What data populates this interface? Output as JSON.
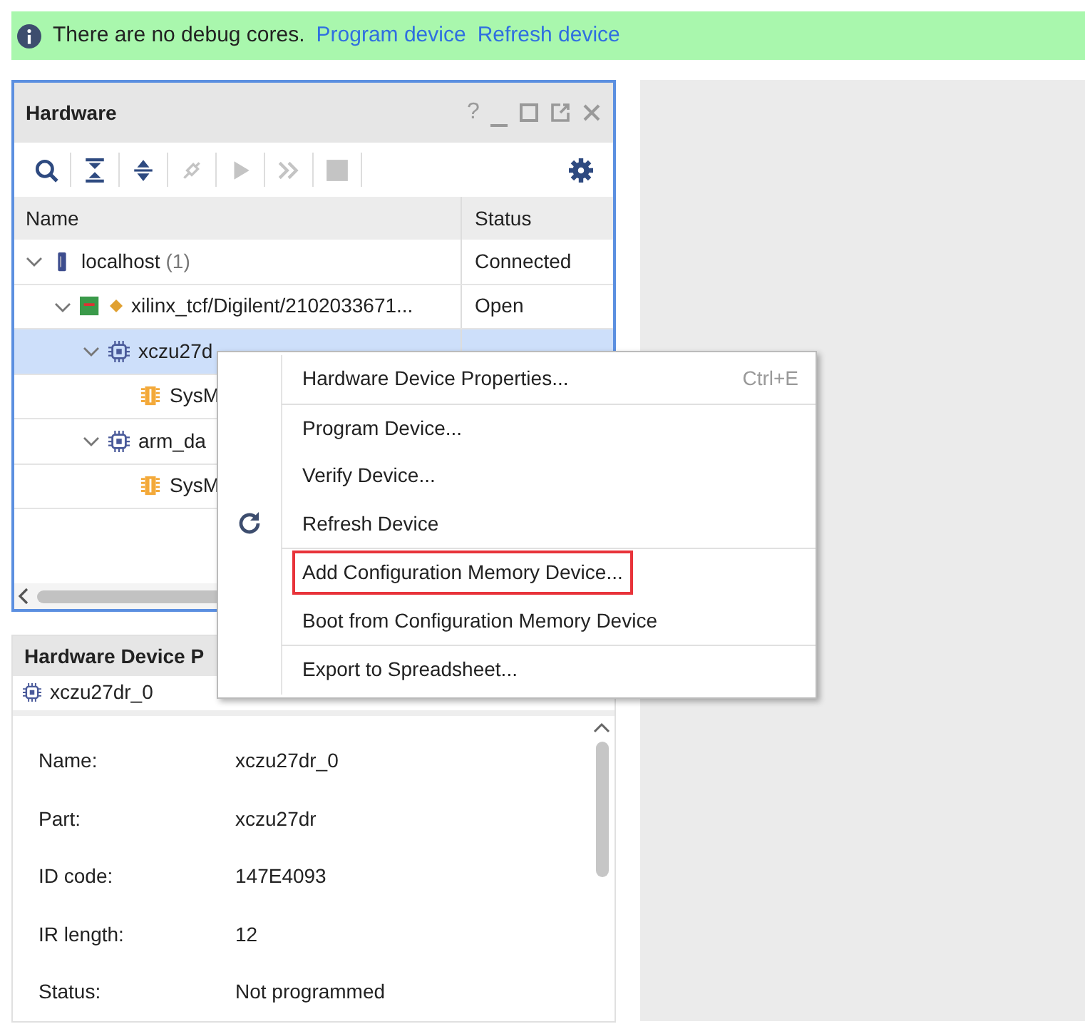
{
  "banner": {
    "message": "There are no debug cores.",
    "links": [
      "Program device",
      "Refresh device"
    ]
  },
  "hardware": {
    "title": "Hardware",
    "help": "?",
    "tools": [
      {
        "kind": "search",
        "disabled": false
      },
      {
        "kind": "collapse",
        "disabled": false
      },
      {
        "kind": "expand",
        "disabled": false
      },
      {
        "kind": "connect",
        "disabled": true
      },
      {
        "kind": "run",
        "disabled": true
      },
      {
        "kind": "step",
        "disabled": true
      },
      {
        "kind": "stop",
        "disabled": true
      },
      {
        "kind": "settings",
        "disabled": false
      }
    ],
    "columns": [
      "Name",
      "Status"
    ],
    "tree": [
      {
        "kind": "host",
        "name": "localhost",
        "count": "(1)",
        "status": "Connected",
        "expanded": true,
        "selected": false,
        "children": [
          {
            "kind": "target",
            "name": "xilinx_tcf/Digilent/2102033671...",
            "status": "Open",
            "expanded": true,
            "selected": false,
            "children": [
              {
                "kind": "chip",
                "name": "xczu27d",
                "expanded": true,
                "selected": true,
                "children": [
                  {
                    "kind": "sysmon",
                    "name": "SysM",
                    "selected": false
                  }
                ]
              },
              {
                "kind": "chip",
                "name": "arm_da",
                "expanded": true,
                "selected": false,
                "children": [
                  {
                    "kind": "sysmon",
                    "name": "SysM",
                    "selected": false
                  }
                ]
              }
            ]
          }
        ]
      }
    ]
  },
  "properties": {
    "title": "Hardware Device P",
    "device": "xczu27dr_0",
    "rows": [
      {
        "label": "Name:",
        "value": "xczu27dr_0"
      },
      {
        "label": "Part:",
        "value": "xczu27dr"
      },
      {
        "label": "ID code:",
        "value": "147E4093"
      },
      {
        "label": "IR length:",
        "value": "12"
      },
      {
        "label": "Status:",
        "value": "Not programmed"
      }
    ]
  },
  "context_menu": {
    "items": [
      {
        "label": "Hardware Device Properties...",
        "shortcut": "Ctrl+E",
        "separator_before": false,
        "highlighted": false
      },
      {
        "label": "Program Device...",
        "separator_before": true,
        "highlighted": false
      },
      {
        "label": "Verify Device...",
        "separator_before": false,
        "highlighted": false
      },
      {
        "label": "Refresh Device",
        "kind": "refresh",
        "separator_before": false,
        "highlighted": false
      },
      {
        "label": "Add Configuration Memory Device...",
        "separator_before": true,
        "highlighted": true
      },
      {
        "label": "Boot from Configuration Memory Device",
        "separator_before": false,
        "highlighted": false
      },
      {
        "label": "Export to Spreadsheet...",
        "separator_before": true,
        "highlighted": false
      }
    ]
  }
}
